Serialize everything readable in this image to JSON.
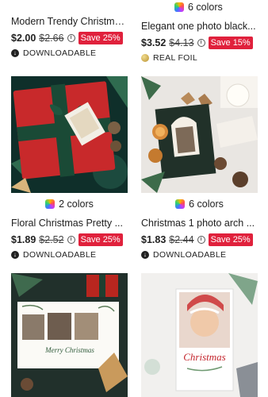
{
  "products": [
    {
      "title": "Modern Trendy Christmas...",
      "price": "$2.00",
      "original_price": "$2.66",
      "discount": "Save 25%",
      "feature": "DOWNLOADABLE",
      "feature_icon": "download-icon"
    },
    {
      "colors": "6 colors",
      "title": "Elegant one photo black...",
      "price": "$3.52",
      "original_price": "$4.13",
      "discount": "Save 15%",
      "feature": "REAL FOIL",
      "feature_icon": "foil-icon"
    },
    {
      "colors": "2 colors",
      "title": "Floral Christmas Pretty ...",
      "price": "$1.89",
      "original_price": "$2.52",
      "discount": "Save 25%",
      "feature": "DOWNLOADABLE",
      "feature_icon": "download-icon",
      "image_icon": "gift-box-card-photo"
    },
    {
      "colors": "6 colors",
      "title": "Christmas 1 photo arch ...",
      "price": "$1.83",
      "original_price": "$2.44",
      "discount": "Save 25%",
      "feature": "DOWNLOADABLE",
      "feature_icon": "download-icon",
      "image_icon": "arch-photo-card"
    },
    {
      "image_icon": "family-photo-card",
      "card_text": "Merry Christmas"
    },
    {
      "image_icon": "child-photo-card",
      "card_text": "Christmas"
    }
  ],
  "colors": {
    "badge": "#e0213c",
    "text": "#212121"
  }
}
